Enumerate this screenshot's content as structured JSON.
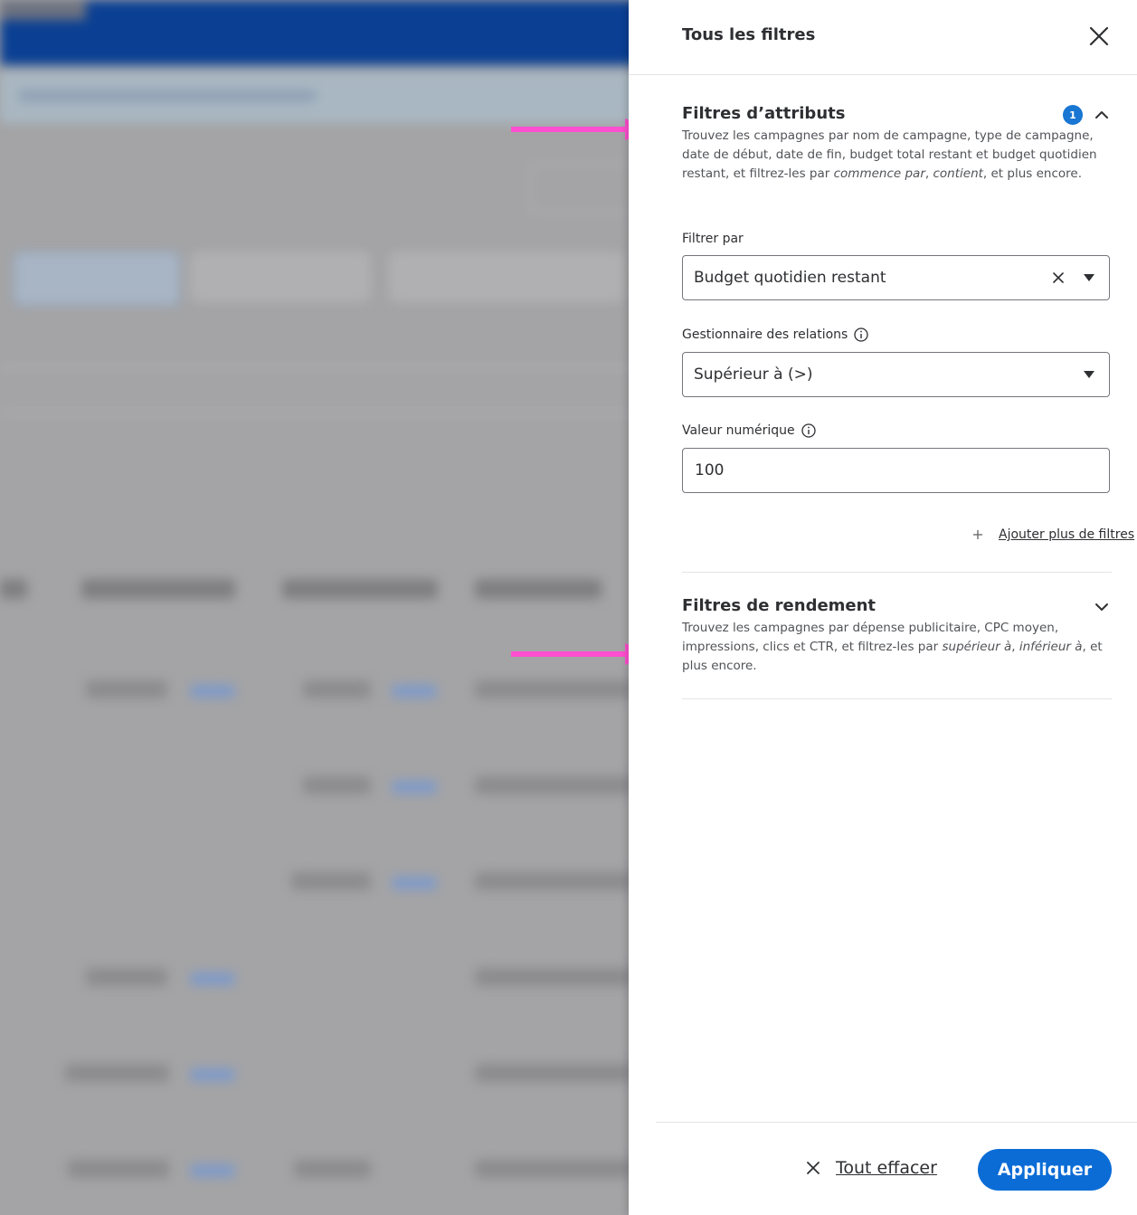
{
  "panel": {
    "title": "Tous les filtres",
    "close_icon": "close-icon"
  },
  "attribute_filters": {
    "title": "Filtres d’attributs",
    "badge_count": "1",
    "expanded": true,
    "desc_main": "Trouvez les campagnes par nom de campagne, type de campagne, date de début, date de fin, budget total restant et budget quotidien restant, et filtrez-les par ",
    "desc_em1": "commence par",
    "desc_sep": ", ",
    "desc_em2": "contient",
    "desc_end": ", et plus encore.",
    "filter_by": {
      "label": "Filtrer par",
      "value": "Budget quotidien restant"
    },
    "relation": {
      "label": "Gestionnaire des relations",
      "value": "Supérieur à (>)"
    },
    "numeric_value": {
      "label": "Valeur numérique",
      "value": "100"
    },
    "add_more_label": "Ajouter plus de filtres"
  },
  "performance_filters": {
    "title": "Filtres de rendement",
    "expanded": false,
    "desc_main": "Trouvez les campagnes par dépense publicitaire, CPC moyen, impressions, clics et CTR, et filtrez-les par ",
    "desc_em1": "supérieur à",
    "desc_sep": ", ",
    "desc_em2": "inférieur à",
    "desc_end": ", et plus encore."
  },
  "footer": {
    "clear_all_label": "Tout effacer",
    "apply_label": "Appliquer"
  },
  "colors": {
    "accent": "#0b6cd6",
    "badge": "#1976d2",
    "arrow": "#ff4fd0"
  }
}
